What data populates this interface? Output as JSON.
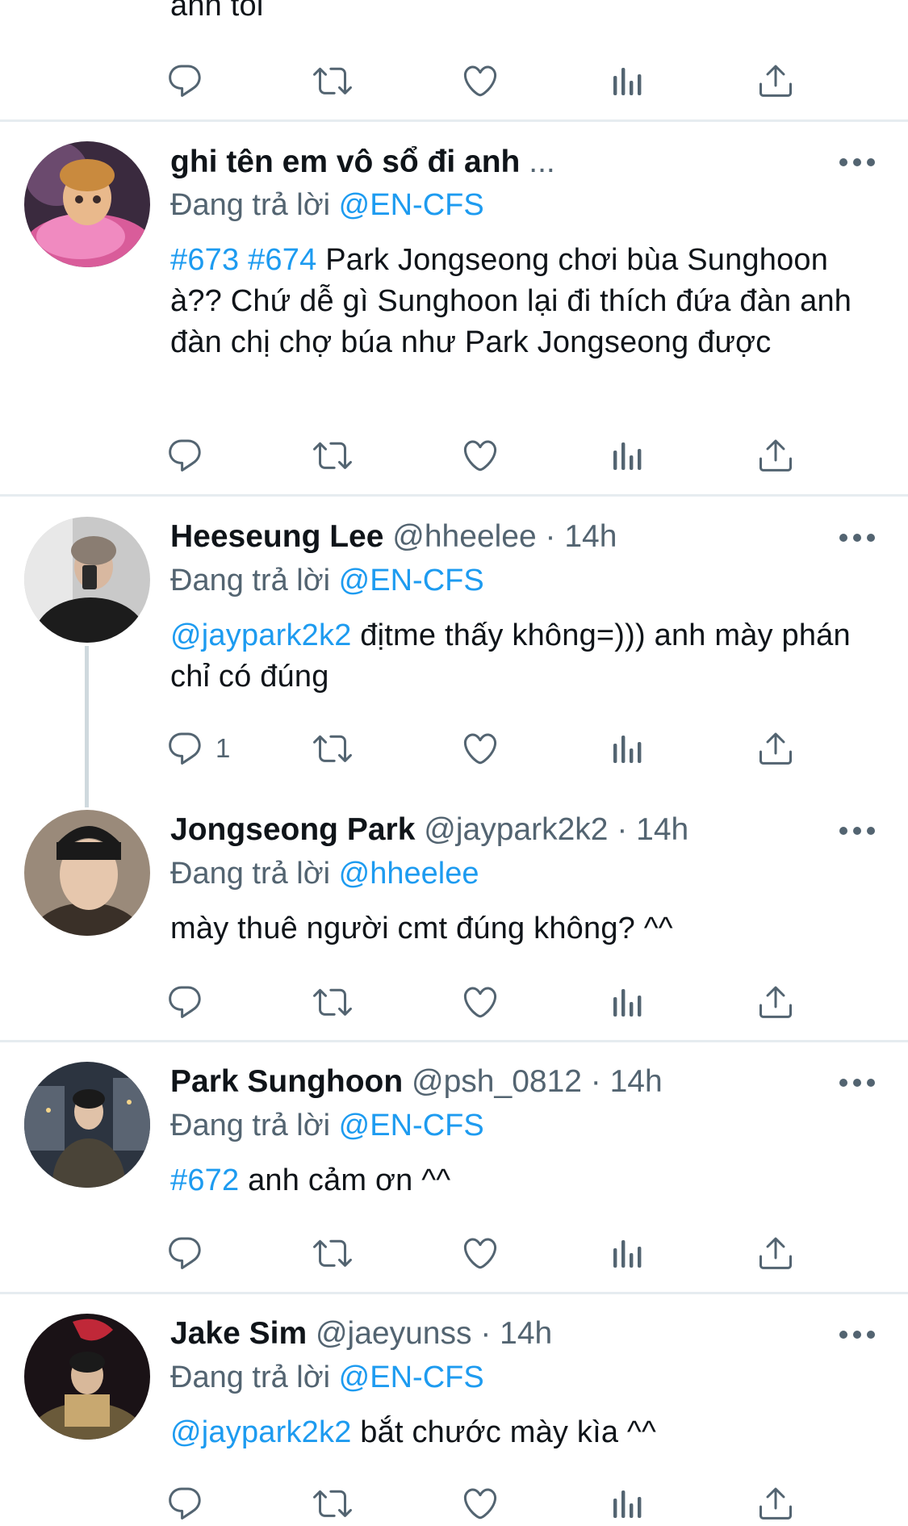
{
  "top_partial": {
    "body_tail": "anh tôi"
  },
  "tweets": [
    {
      "name": "ghi tên em vô sổ đi anh",
      "name_ellipsis": "...",
      "handle": "",
      "time": "",
      "replying_prefix": "Đang trả lời ",
      "replying_to": "@EN-CFS",
      "body_segments": [
        {
          "text": "#673 #674",
          "link": true
        },
        {
          "text": " Park Jongseong chơi bùa Sunghoon à?? Chứ dễ gì Sunghoon lại đi thích đứa đàn anh đàn chị chợ búa như Park Jongseong được",
          "link": false
        }
      ],
      "reply_count": ""
    },
    {
      "name": "Heeseung Lee",
      "handle": "@hheelee",
      "time": "· 14h",
      "replying_prefix": "Đang trả lời ",
      "replying_to": "@EN-CFS",
      "body_segments": [
        {
          "text": "@jaypark2k2",
          "link": true
        },
        {
          "text": " địtme thấy không=))) anh mày phán chỉ có đúng",
          "link": false
        }
      ],
      "reply_count": "1"
    },
    {
      "name": "Jongseong Park",
      "handle": "@jaypark2k2",
      "time": "· 14h",
      "replying_prefix": "Đang trả lời ",
      "replying_to": "@hheelee",
      "body_segments": [
        {
          "text": "mày thuê người cmt đúng không? ^^",
          "link": false
        }
      ],
      "reply_count": ""
    },
    {
      "name": "Park Sunghoon",
      "handle": "@psh_0812",
      "time": "· 14h",
      "replying_prefix": "Đang trả lời ",
      "replying_to": "@EN-CFS",
      "body_segments": [
        {
          "text": "#672",
          "link": true
        },
        {
          "text": " anh cảm ơn ^^",
          "link": false
        }
      ],
      "reply_count": ""
    },
    {
      "name": "Jake Sim",
      "handle": "@jaeyunss",
      "time": "· 14h",
      "replying_prefix": "Đang trả lời ",
      "replying_to": "@EN-CFS",
      "body_segments": [
        {
          "text": "@jaypark2k2",
          "link": true
        },
        {
          "text": " bắt chước mày kìa ^^",
          "link": false
        }
      ],
      "reply_count": ""
    }
  ],
  "icons": {
    "reply": "reply-icon",
    "retweet": "retweet-icon",
    "like": "heart-icon",
    "analytics": "analytics-icon",
    "share": "share-icon",
    "more": "more-icon"
  },
  "colors": {
    "link": "#1d9bf0",
    "meta": "#536471",
    "text": "#0f1419",
    "divider": "#e6ecf0"
  }
}
